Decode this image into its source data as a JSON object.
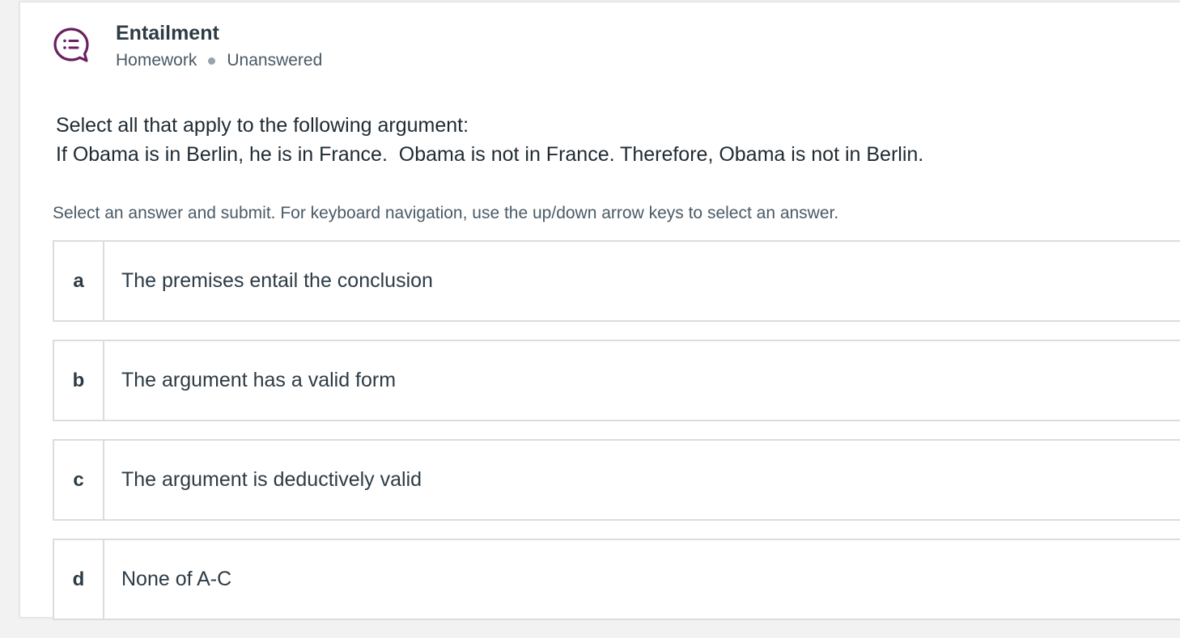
{
  "header": {
    "title": "Entailment",
    "type": "Homework",
    "status": "Unanswered",
    "icon": "discussion-list-icon",
    "accent_color": "#6b1f5e"
  },
  "question": {
    "line1": "Select all that apply to the following argument:",
    "line2": "If Obama is in Berlin, he is in France.  Obama is not in France. Therefore, Obama is not in Berlin."
  },
  "instructions": "Select an answer and submit. For keyboard navigation, use the up/down arrow keys to select an answer.",
  "options": [
    {
      "letter": "a",
      "text": "The premises entail the conclusion"
    },
    {
      "letter": "b",
      "text": "The argument has a valid form"
    },
    {
      "letter": "c",
      "text": "The argument is deductively valid"
    },
    {
      "letter": "d",
      "text": "None of A-C"
    }
  ]
}
